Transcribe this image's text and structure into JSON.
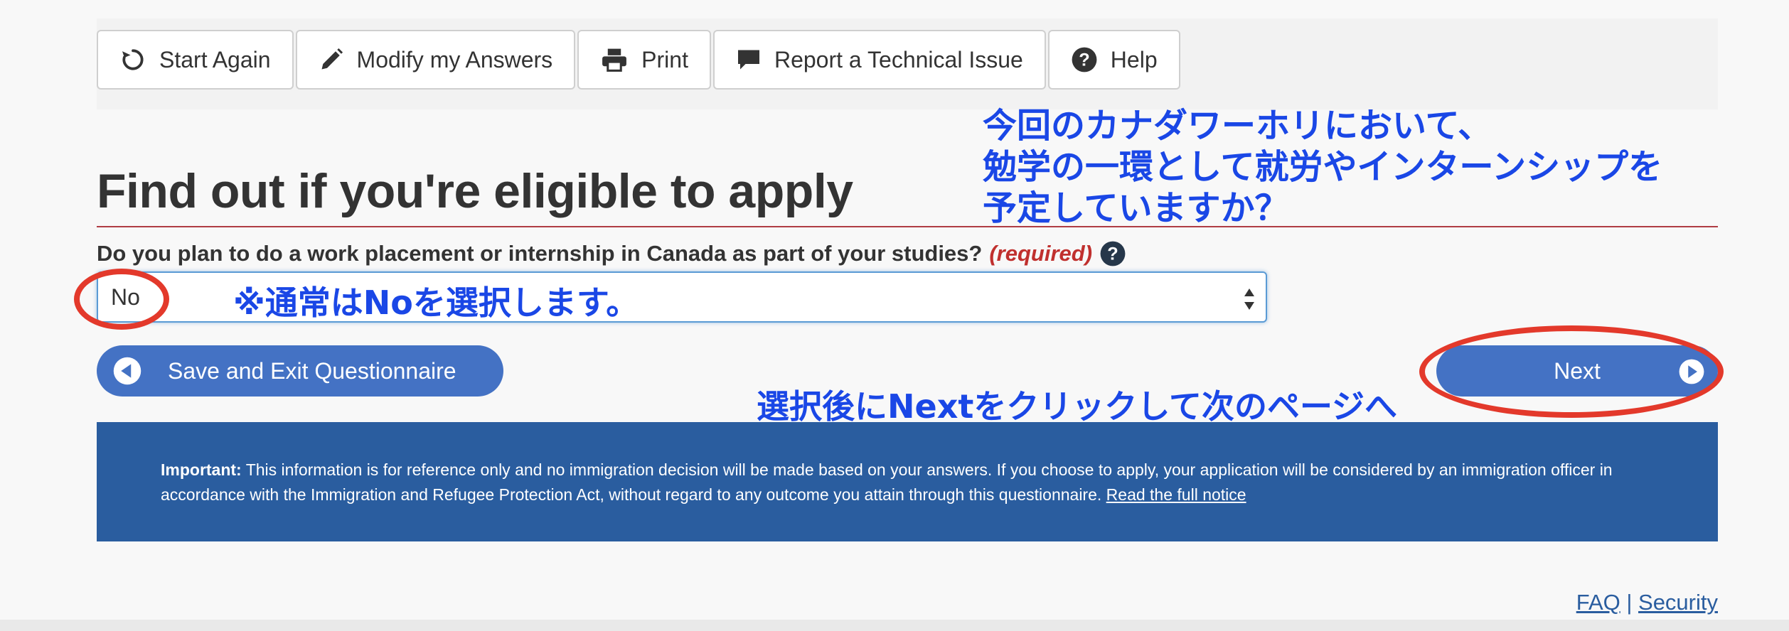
{
  "toolbar": {
    "start_again": "Start Again",
    "modify_answers": "Modify my Answers",
    "print": "Print",
    "report_issue": "Report a Technical Issue",
    "help": "Help"
  },
  "page": {
    "heading": "Find out if you're eligible to apply"
  },
  "question": {
    "text": "Do you plan to do a work placement or internship in Canada as part of your studies?",
    "required": "(required)",
    "selected_value": "No"
  },
  "actions": {
    "save_exit": "Save and Exit Questionnaire",
    "next": "Next"
  },
  "notice": {
    "important_label": "Important:",
    "body": " This information is for reference only and no immigration decision will be made based on your answers. If you choose to apply, your application will be considered by an immigration officer in accordance with the Immigration and Refugee Protection Act, without regard to any outcome you attain through this questionnaire. ",
    "link": "Read the full notice"
  },
  "footer": {
    "faq": "FAQ",
    "separator": " | ",
    "security": "Security"
  },
  "annotations": {
    "main_line1": "今回のカナダワーホリにおいて、",
    "main_line2": "勉学の一環として就労やインターンシップを",
    "main_line3": "予定していますか？",
    "select_hint": "※通常はNoを選択します。",
    "next_hint": "選択後にNextをクリックして次のページへ"
  },
  "colors": {
    "accent_blue": "#4472c4",
    "notice_blue": "#2a5d9f",
    "rule_red": "#af3c43",
    "annotation_blue": "#1a47e6",
    "annotation_red": "#e3392b"
  }
}
